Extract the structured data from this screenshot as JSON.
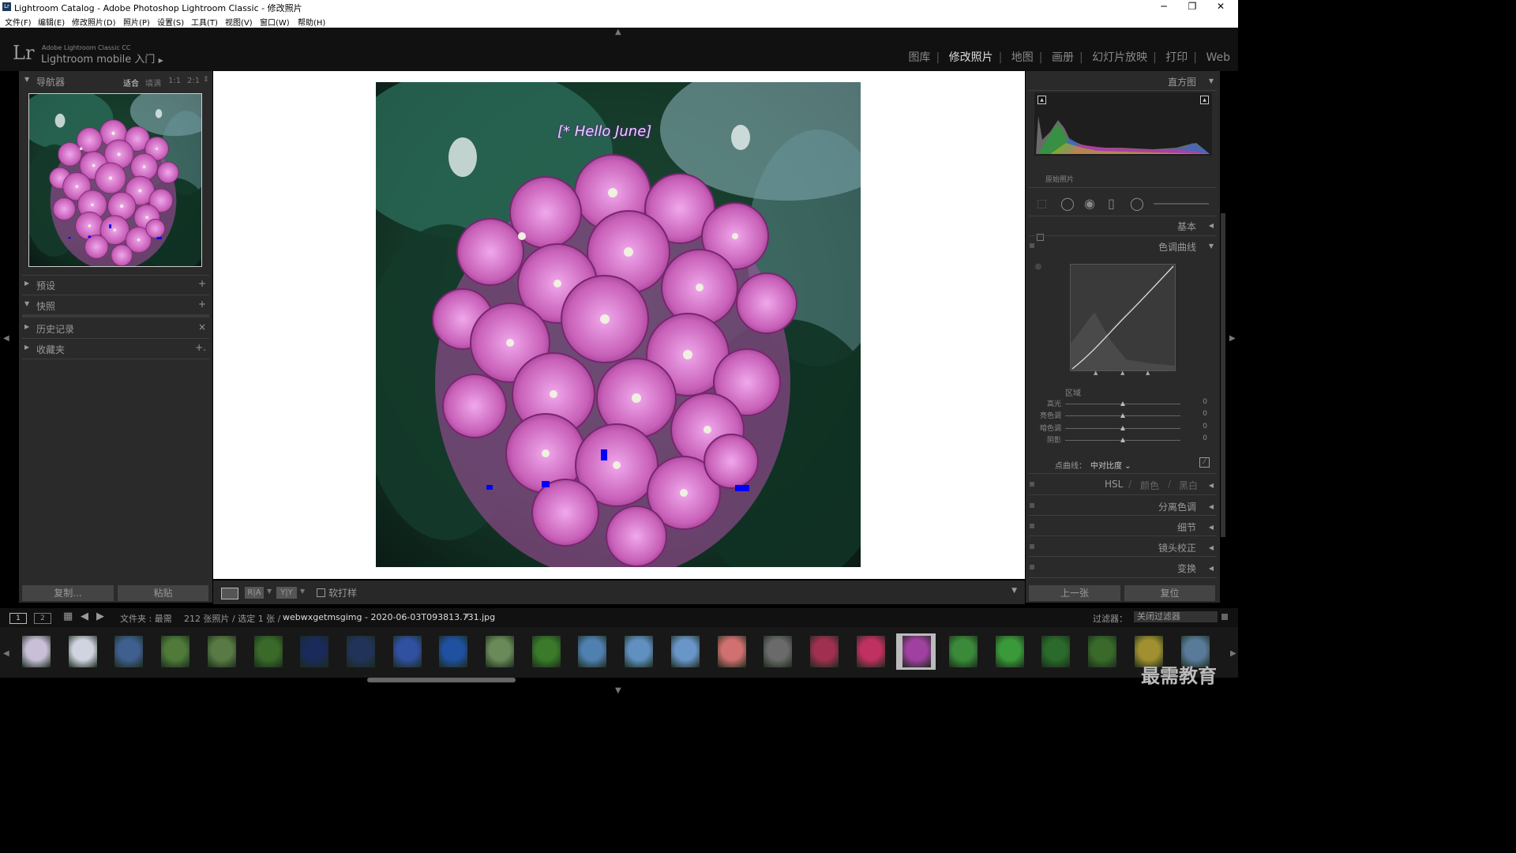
{
  "window": {
    "title": "Lightroom Catalog - Adobe Photoshop Lightroom Classic - 修改照片",
    "app_icon": "Lr",
    "controls": {
      "minimize": "─",
      "restore": "❐",
      "close": "✕"
    }
  },
  "menu": [
    "文件(F)",
    "编辑(E)",
    "修改照片(D)",
    "照片(P)",
    "设置(S)",
    "工具(T)",
    "视图(V)",
    "窗口(W)",
    "帮助(H)"
  ],
  "header": {
    "logo": "Lr",
    "product": "Adobe Lightroom Classic CC",
    "identity": "Lightroom mobile 入门",
    "modules": [
      {
        "label": "图库",
        "active": false
      },
      {
        "label": "修改照片",
        "active": true
      },
      {
        "label": "地图",
        "active": false
      },
      {
        "label": "画册",
        "active": false
      },
      {
        "label": "幻灯片放映",
        "active": false
      },
      {
        "label": "打印",
        "active": false
      },
      {
        "label": "Web",
        "active": false
      }
    ]
  },
  "left": {
    "navigator": {
      "title": "导航器",
      "zoom": [
        "适合",
        "填满",
        "1:1",
        "2:1"
      ]
    },
    "panels": [
      {
        "label": "预设",
        "action": "+"
      },
      {
        "label": "快照",
        "action": "+"
      },
      {
        "label": "历史记录",
        "action": "×"
      },
      {
        "label": "收藏夹",
        "action": "+."
      }
    ],
    "copy_button": "复制...",
    "paste_button": "粘贴"
  },
  "image": {
    "overlay_text": "[* Hello June]"
  },
  "toolbar": {
    "view_a": "R|A",
    "view_b": "Y|Y",
    "softproof": "软打样"
  },
  "right": {
    "histogram_title": "直方图",
    "original_photo": "原始照片",
    "basic": "基本",
    "tone_curve": "色调曲线",
    "region_label": "区域",
    "sliders": [
      {
        "label": "高光",
        "value": "0"
      },
      {
        "label": "亮色调",
        "value": "0"
      },
      {
        "label": "暗色调",
        "value": "0"
      },
      {
        "label": "阴影",
        "value": "0"
      }
    ],
    "point_curve_label": "点曲线：",
    "point_curve_value": "中对比度 ⌄",
    "hsl": [
      "HSL",
      "颜色",
      "黑白"
    ],
    "panels": [
      "分离色调",
      "细节",
      "镜头校正",
      "变换"
    ],
    "prev_button": "上一张",
    "reset_button": "复位"
  },
  "filmstrip": {
    "screens": [
      "1",
      "2"
    ],
    "source": "文件夹 : 最需",
    "count": "212 张照片 / 选定 1 张 /",
    "filename": "webwxgetmsgimg - 2020-06-03T093813.731.jpg",
    "filter_label": "过滤器：",
    "filter_value": "关闭过滤器",
    "thumb_colors": [
      "#c9c0d8",
      "#d0d4e0",
      "#3f5f8f",
      "#4f7a3a",
      "#5a7a45",
      "#3a6a2a",
      "#1a2a5a",
      "#22335a",
      "#3050a0",
      "#2050a0",
      "#6a8a5a",
      "#3a7a2a",
      "#5080b0",
      "#6090c0",
      "#6a95c8",
      "#d07070",
      "#6a6a6a",
      "#a03050",
      "#c03060",
      "#a040a0",
      "#3a8a3a",
      "#3a9a3a",
      "#2a6a2a",
      "#3a6a2a",
      "#a09030",
      "#5a7a9a"
    ],
    "selected_index": 19
  },
  "watermark": "最需教育"
}
